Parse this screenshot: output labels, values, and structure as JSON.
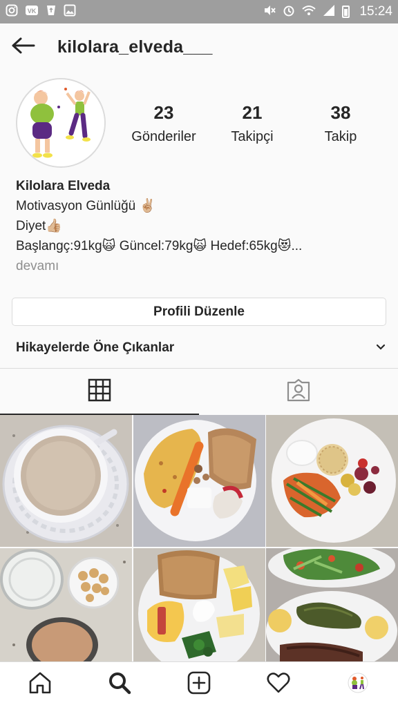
{
  "status_bar": {
    "time": "15:24",
    "left_icons": [
      "instagram-icon",
      "vk-icon",
      "recycle-icon",
      "gallery-icon"
    ],
    "right_icons": [
      "mute-icon",
      "alarm-icon",
      "wifi-icon",
      "signal-icon",
      "battery-icon"
    ]
  },
  "header": {
    "username": "kilolara_elveda___"
  },
  "profile": {
    "stats": [
      {
        "value": "23",
        "label": "Gönderiler"
      },
      {
        "value": "21",
        "label": "Takipçi"
      },
      {
        "value": "38",
        "label": "Takip"
      }
    ],
    "name": "Kilolara Elveda",
    "bio_lines": [
      "Motivasyon Günlüğü ✌🏼",
      "Diyet👍🏼",
      "Başlangç:91kg🙀 Güncel:79kg🙀 Hedef:65kg😻..."
    ],
    "more": "devamı",
    "edit_button": "Profili Düzenle",
    "highlights_label": "Hikayelerde Öne Çıkanlar"
  },
  "tabs": [
    {
      "icon": "grid-icon",
      "active": true
    },
    {
      "icon": "tagged-icon",
      "active": false
    }
  ],
  "grid_posts": [
    {
      "subject": "cup of coffee with milk"
    },
    {
      "subject": "omelette, carrot, bread, apple breakfast"
    },
    {
      "subject": "rice cake, cheese, carrot salad, fruit"
    },
    {
      "subject": "glass of water, eggs, coffee"
    },
    {
      "subject": "toast, scrambled eggs, cheese breakfast"
    },
    {
      "subject": "salad with peppers and meatballs"
    }
  ],
  "bottom_nav": [
    {
      "icon": "home-icon"
    },
    {
      "icon": "search-icon"
    },
    {
      "icon": "add-post-icon"
    },
    {
      "icon": "heart-icon"
    },
    {
      "icon": "profile-avatar-icon"
    }
  ]
}
